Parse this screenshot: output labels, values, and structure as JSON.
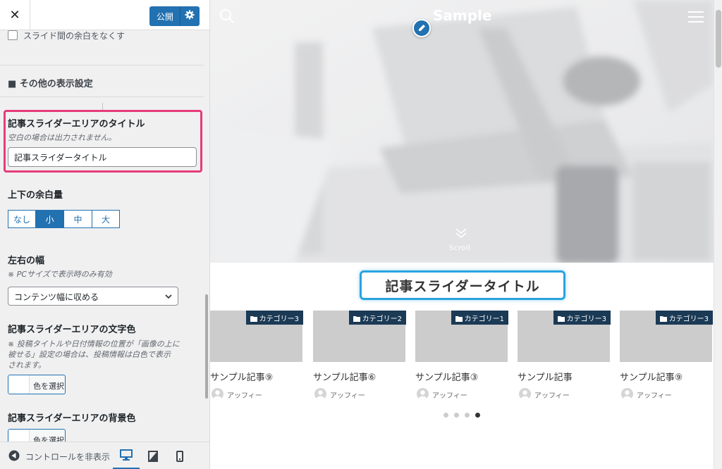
{
  "sidebar": {
    "publish_label": "公開",
    "checkbox_label": "スライド間の余白をなくす",
    "section_heading": "■ その他の表示設定",
    "title_field": {
      "label": "記事スライダーエリアのタイトル",
      "description": "空白の場合は出力されません。",
      "value": "記事スライダータイトル"
    },
    "padding": {
      "label": "上下の余白量",
      "options": [
        "なし",
        "小",
        "中",
        "大"
      ],
      "selected": "小"
    },
    "width": {
      "label": "左右の幅",
      "note": "※ PCサイズで表示時のみ有効",
      "selected": "コンテンツ幅に収める"
    },
    "text_color": {
      "label": "記事スライダーエリアの文字色",
      "note_line1": "※ 投稿タイトルや日付情報の位置が「画像の上に",
      "note_line2": "被せる」設定の場合は、投稿情報は白色で表示",
      "note_line3": "されます。",
      "button": "色を選択"
    },
    "bg_color": {
      "label": "記事スライダーエリアの背景色",
      "button": "色を選択"
    },
    "footer": {
      "hide_controls": "コントロールを非表示",
      "devices": [
        "desktop",
        "tablet",
        "mobile"
      ],
      "active_device": "desktop"
    }
  },
  "preview": {
    "site_title": "Sample",
    "scroll_label": "Scroll",
    "slider_title": "記事スライダータイトル",
    "cards": [
      {
        "category": "カテゴリー3",
        "title": "サンプル記事⑨",
        "author": "アッフィー"
      },
      {
        "category": "カテゴリー2",
        "title": "サンプル記事⑥",
        "author": "アッフィー"
      },
      {
        "category": "カテゴリー1",
        "title": "サンプル記事③",
        "author": "アッフィー"
      },
      {
        "category": "カテゴリー3",
        "title": "サンプル記事",
        "author": "アッフィー"
      },
      {
        "category": "カテゴリー3",
        "title": "サンプル記事⑨",
        "author": "アッフィー"
      }
    ],
    "pagination": {
      "count": 4,
      "active": 4
    }
  },
  "colors": {
    "primary": "#2271b1",
    "highlight_pink": "#e63b7a",
    "highlight_blue": "#29a3e0",
    "category_badge": "#1b3a55"
  }
}
